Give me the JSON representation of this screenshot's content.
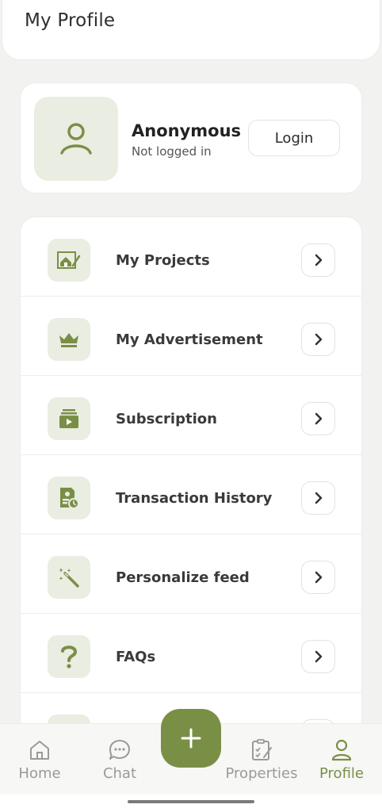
{
  "header": {
    "title": "My Profile"
  },
  "profile": {
    "name": "Anonymous",
    "status": "Not logged in",
    "login_label": "Login"
  },
  "menu": {
    "items": [
      {
        "label": "My Projects",
        "icon": "projects-icon"
      },
      {
        "label": "My Advertisement",
        "icon": "crown-icon"
      },
      {
        "label": "Subscription",
        "icon": "subscription-icon"
      },
      {
        "label": "Transaction History",
        "icon": "transaction-history-icon"
      },
      {
        "label": "Personalize feed",
        "icon": "magic-wand-icon"
      },
      {
        "label": "FAQs",
        "icon": "question-icon"
      }
    ]
  },
  "nav": {
    "items": [
      {
        "label": "Home",
        "icon": "home-icon",
        "active": false
      },
      {
        "label": "Chat",
        "icon": "chat-icon",
        "active": false
      },
      {
        "label": "Properties",
        "icon": "properties-icon",
        "active": false
      },
      {
        "label": "Profile",
        "icon": "profile-icon",
        "active": true
      }
    ],
    "fab_icon": "plus-icon"
  },
  "colors": {
    "accent": "#7a8f46",
    "icon_bg": "#eaede2",
    "inactive": "#9a9a96"
  }
}
